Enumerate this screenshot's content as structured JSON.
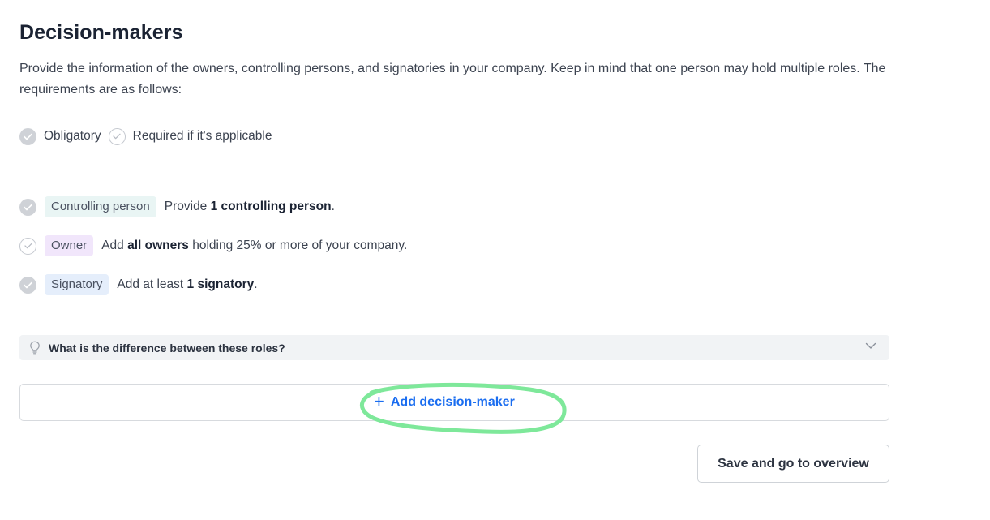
{
  "header": {
    "title": "Decision-makers",
    "intro": "Provide the information of the owners, controlling persons, and signatories in your company. Keep in mind that one person may hold multiple roles. The requirements are as follows:"
  },
  "legend": {
    "obligatory_label": "Obligatory",
    "applicable_label": "Required if it's applicable"
  },
  "requirements": [
    {
      "role": "Controlling person",
      "text_before": "Provide ",
      "text_bold": "1 controlling person",
      "text_after": ".",
      "check": "filled"
    },
    {
      "role": "Owner",
      "text_before": "Add ",
      "text_bold": "all owners",
      "text_after": " holding 25% or more of your company.",
      "check": "outline"
    },
    {
      "role": "Signatory",
      "text_before": "Add at least ",
      "text_bold": "1 signatory",
      "text_after": ".",
      "check": "filled"
    }
  ],
  "faq": {
    "question": "What is the difference between these roles?",
    "icon": "lightbulb-icon",
    "expand_icon": "chevron-down-icon"
  },
  "actions": {
    "add_plus": "+",
    "add_label": "Add decision-maker",
    "save_label": "Save and go to overview"
  },
  "colors": {
    "accent": "#1a6df0",
    "highlight_annotation": "#7ee89a",
    "chip_controlling": "#e9f5f4",
    "chip_owner": "#f1e6fb",
    "chip_signatory": "#e5eefb"
  }
}
